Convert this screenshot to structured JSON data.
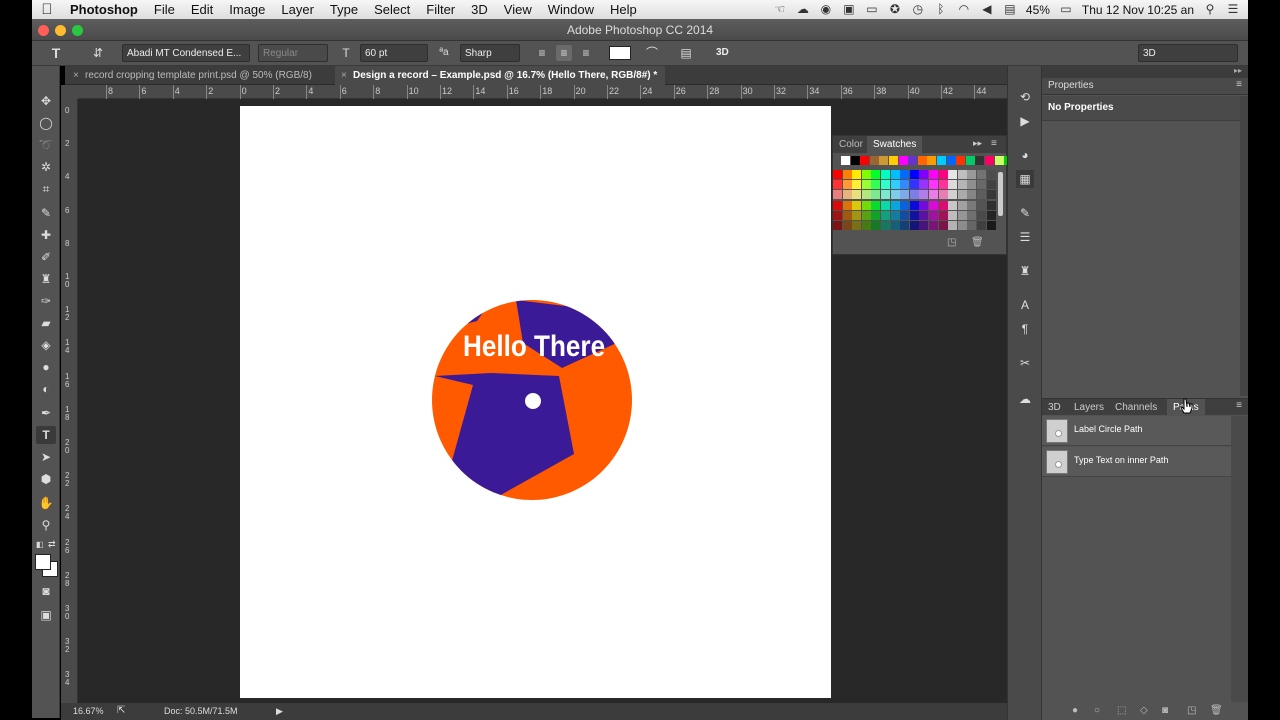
{
  "menubar": {
    "app": "Photoshop",
    "items": [
      "File",
      "Edit",
      "Image",
      "Layer",
      "Type",
      "Select",
      "Filter",
      "3D",
      "View",
      "Window",
      "Help"
    ],
    "battery": "45%",
    "datetime": "Thu 12 Nov  10:25 an"
  },
  "window": {
    "title": "Adobe Photoshop CC 2014"
  },
  "options": {
    "font_family": "Abadi MT Condensed E...",
    "font_style": "Regular",
    "font_size": "60 pt",
    "antialias": "Sharp",
    "mode_3d": "3D",
    "workspace": "3D"
  },
  "tabs": [
    {
      "label": "record cropping template print.psd @ 50% (RGB/8)"
    },
    {
      "label": "Design a record – Example.psd @ 16.7% (Hello There, RGB/8#) *"
    }
  ],
  "rulers": {
    "h": [
      "8",
      "6",
      "4",
      "2",
      "0",
      "2",
      "4",
      "6",
      "8",
      "10",
      "12",
      "14",
      "16",
      "18",
      "20",
      "22",
      "24",
      "26",
      "28",
      "30",
      "32",
      "34",
      "36",
      "38",
      "40",
      "42",
      "44"
    ],
    "v": [
      "0",
      "2",
      "4",
      "6",
      "8",
      "1\n0",
      "1\n2",
      "1\n4",
      "1\n6",
      "1\n8",
      "2\n0",
      "2\n2",
      "2\n4",
      "2\n6",
      "2\n8",
      "3\n0",
      "3\n2",
      "3\n4"
    ]
  },
  "canvas": {
    "text": "Hello There",
    "colors": {
      "orange": "#ff5a00",
      "purple": "#3a1a96"
    }
  },
  "status": {
    "zoom": "16.67%",
    "doc": "Doc: 50.5M/71.5M"
  },
  "swatches_panel": {
    "tabs": [
      "Color",
      "Swatches"
    ],
    "active_tab": "Swatches"
  },
  "properties": {
    "title": "Properties",
    "body": "No Properties"
  },
  "paths_panel": {
    "tabs": [
      "3D",
      "Layers",
      "Channels",
      "Paths"
    ],
    "active_tab": "Paths",
    "rows": [
      {
        "label": "Label Circle Path"
      },
      {
        "label": "Type Text on inner Path"
      }
    ]
  }
}
